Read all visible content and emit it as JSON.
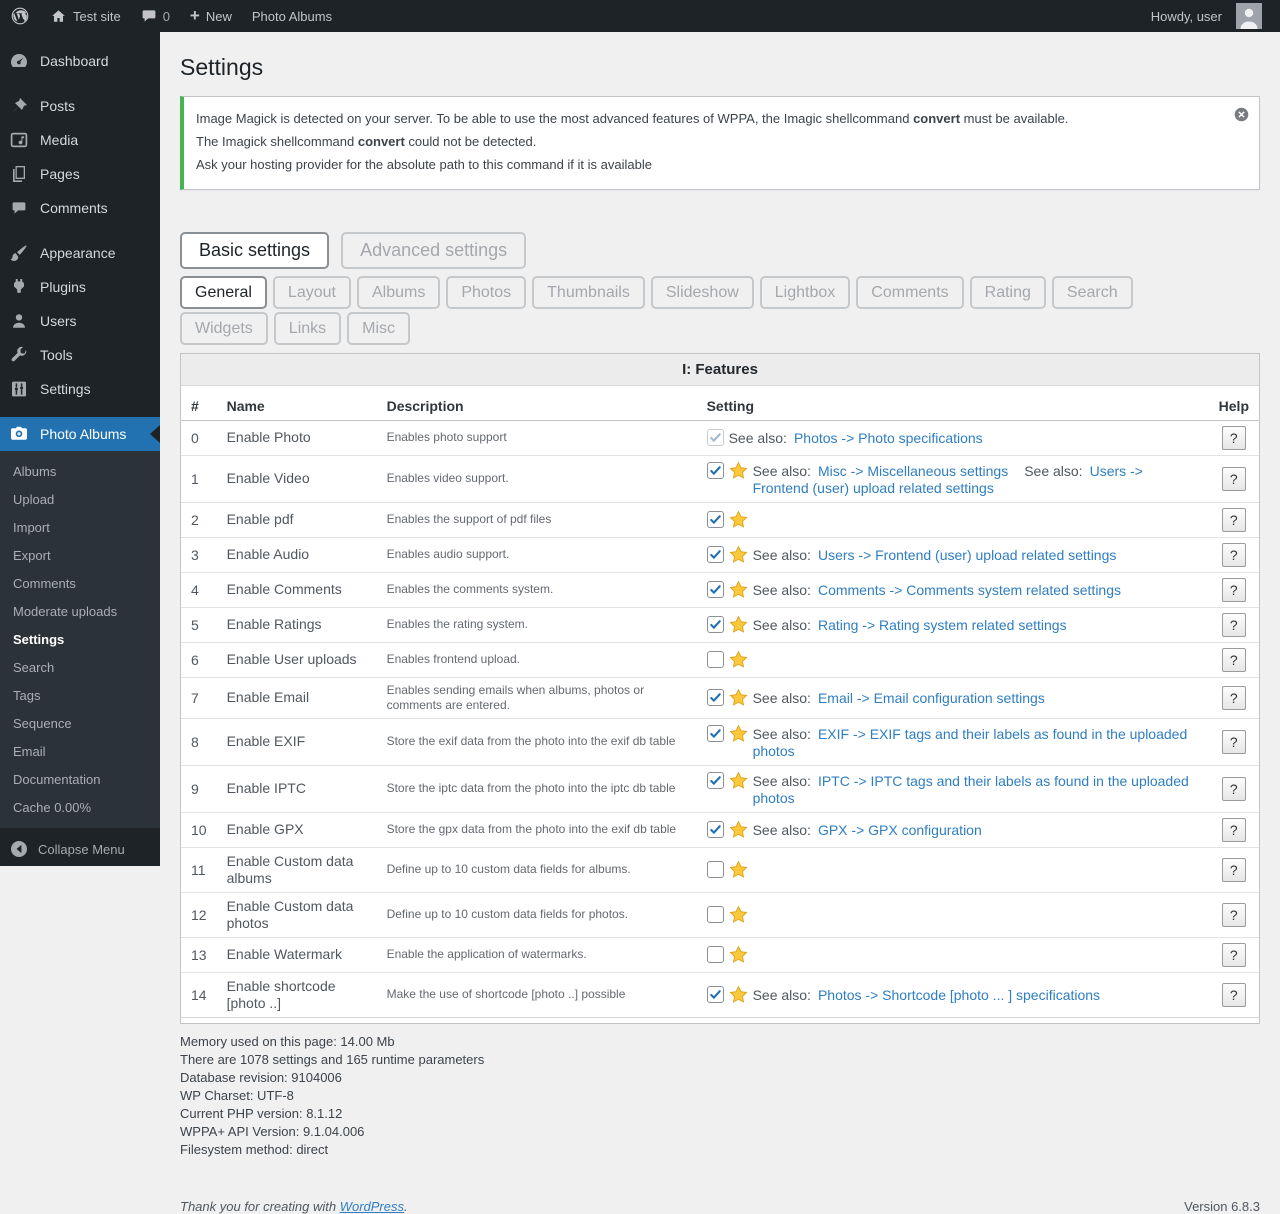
{
  "colors": {
    "accent": "#2271b1",
    "notice_green": "#46b450",
    "star_gold": "#fcc93d",
    "link": "#2f7ec2"
  },
  "admin_bar": {
    "site_name": "Test site",
    "comment_count": "0",
    "new_label": "New",
    "plugin_label": "Photo Albums",
    "howdy": "Howdy, user"
  },
  "sidebar": {
    "items": [
      {
        "label": "Dashboard",
        "icon": "dashboard-icon"
      },
      {
        "label": "Posts",
        "icon": "pushpin-icon",
        "separator_before": true
      },
      {
        "label": "Media",
        "icon": "media-icon"
      },
      {
        "label": "Pages",
        "icon": "pages-icon"
      },
      {
        "label": "Comments",
        "icon": "comment-bubble-icon"
      },
      {
        "label": "Appearance",
        "icon": "brush-icon",
        "separator_before": true
      },
      {
        "label": "Plugins",
        "icon": "plugin-icon"
      },
      {
        "label": "Users",
        "icon": "user-icon"
      },
      {
        "label": "Tools",
        "icon": "wrench-icon"
      },
      {
        "label": "Settings",
        "icon": "sliders-icon"
      },
      {
        "label": "Photo Albums",
        "icon": "camera-icon",
        "active": true,
        "separator_before": true
      }
    ],
    "submenu": [
      "Albums",
      "Upload",
      "Import",
      "Export",
      "Comments",
      "Moderate uploads",
      "Settings",
      "Search",
      "Tags",
      "Sequence",
      "Email",
      "Documentation",
      "Cache 0.00%"
    ],
    "submenu_current": "Settings",
    "collapse_label": "Collapse Menu"
  },
  "page": {
    "title": "Settings",
    "notice": {
      "line1_pre": "Image Magick is detected on your server. To be able to use the most advanced features of WPPA, the Imagic shellcommand ",
      "line1_bold": "convert",
      "line1_post": " must be available.",
      "line2_pre": "The Imagick shellcommand ",
      "line2_bold": "convert",
      "line2_post": " could not be detected.",
      "line3": "Ask your hosting provider for the absolute path to this command if it is available"
    },
    "top_tabs": [
      {
        "label": "Basic settings",
        "active": true
      },
      {
        "label": "Advanced settings",
        "active": false
      }
    ],
    "sub_tabs": [
      {
        "label": "General",
        "active": true
      },
      {
        "label": "Layout",
        "active": false
      },
      {
        "label": "Albums",
        "active": false
      },
      {
        "label": "Photos",
        "active": false
      },
      {
        "label": "Thumbnails",
        "active": false
      },
      {
        "label": "Slideshow",
        "active": false
      },
      {
        "label": "Lightbox",
        "active": false
      },
      {
        "label": "Comments",
        "active": false
      },
      {
        "label": "Rating",
        "active": false
      },
      {
        "label": "Search",
        "active": false
      },
      {
        "label": "Widgets",
        "active": false
      },
      {
        "label": "Links",
        "active": false
      },
      {
        "label": "Misc",
        "active": false
      }
    ]
  },
  "table": {
    "title": "I: Features",
    "columns": [
      "#",
      "Name",
      "Description",
      "Setting",
      "Help"
    ],
    "see_also_label": "See also:",
    "help_label": "?",
    "rows": [
      {
        "num": "0",
        "name": "Enable Photo",
        "description": "Enables photo support",
        "checked": true,
        "disabled": true,
        "star": false,
        "links": [
          "Photos -> Photo specifications"
        ]
      },
      {
        "num": "1",
        "name": "Enable Video",
        "description": "Enables video support.",
        "checked": true,
        "disabled": false,
        "star": true,
        "links": [
          "Misc -> Miscellaneous settings",
          "Users -> Frontend (user) upload related settings"
        ]
      },
      {
        "num": "2",
        "name": "Enable pdf",
        "description": "Enables the support of pdf files",
        "checked": true,
        "disabled": false,
        "star": true,
        "links": []
      },
      {
        "num": "3",
        "name": "Enable Audio",
        "description": "Enables audio support.",
        "checked": true,
        "disabled": false,
        "star": true,
        "links": [
          "Users -> Frontend (user) upload related settings"
        ]
      },
      {
        "num": "4",
        "name": "Enable Comments",
        "description": "Enables the comments system.",
        "checked": true,
        "disabled": false,
        "star": true,
        "links": [
          "Comments -> Comments system related settings"
        ]
      },
      {
        "num": "5",
        "name": "Enable Ratings",
        "description": "Enables the rating system.",
        "checked": true,
        "disabled": false,
        "star": true,
        "links": [
          "Rating -> Rating system related settings"
        ]
      },
      {
        "num": "6",
        "name": "Enable User uploads",
        "description": "Enables frontend upload.",
        "checked": false,
        "disabled": false,
        "star": true,
        "links": []
      },
      {
        "num": "7",
        "name": "Enable Email",
        "description": "Enables sending emails when albums, photos or comments are entered.",
        "checked": true,
        "disabled": false,
        "star": true,
        "links": [
          "Email -> Email configuration settings"
        ]
      },
      {
        "num": "8",
        "name": "Enable EXIF",
        "description": "Store the exif data from the photo into the exif db table",
        "checked": true,
        "disabled": false,
        "star": true,
        "links": [
          "EXIF -> EXIF tags and their labels as found in the uploaded photos"
        ]
      },
      {
        "num": "9",
        "name": "Enable IPTC",
        "description": "Store the iptc data from the photo into the iptc db table",
        "checked": true,
        "disabled": false,
        "star": true,
        "links": [
          "IPTC -> IPTC tags and their labels as found in the uploaded photos"
        ]
      },
      {
        "num": "10",
        "name": "Enable GPX",
        "description": "Store the gpx data from the photo into the exif db table",
        "checked": true,
        "disabled": false,
        "star": true,
        "links": [
          "GPX -> GPX configuration"
        ]
      },
      {
        "num": "11",
        "name": "Enable Custom data albums",
        "description": "Define up to 10 custom data fields for albums.",
        "checked": false,
        "disabled": false,
        "star": true,
        "links": []
      },
      {
        "num": "12",
        "name": "Enable Custom data photos",
        "description": "Define up to 10 custom data fields for photos.",
        "checked": false,
        "disabled": false,
        "star": true,
        "links": []
      },
      {
        "num": "13",
        "name": "Enable Watermark",
        "description": "Enable the application of watermarks.",
        "checked": false,
        "disabled": false,
        "star": true,
        "links": []
      },
      {
        "num": "14",
        "name": "Enable shortcode [photo ..]",
        "description": "Make the use of shortcode [photo ..] possible",
        "checked": true,
        "disabled": false,
        "star": true,
        "links": [
          "Photos -> Shortcode [photo ... ] specifications"
        ]
      }
    ]
  },
  "system_info": [
    "Memory used on this page: 14.00 Mb",
    "There are 1078 settings and 165 runtime parameters",
    "Database revision: 9104006",
    "WP Charset: UTF-8",
    "Current PHP version: 8.1.12",
    "WPPA+ API Version: 9.1.04.006",
    "Filesystem method: direct"
  ],
  "footer": {
    "thanks_pre": "Thank you for creating with ",
    "wordpress_link": "WordPress",
    "thanks_post": ".",
    "version": "Version 6.8.3"
  }
}
